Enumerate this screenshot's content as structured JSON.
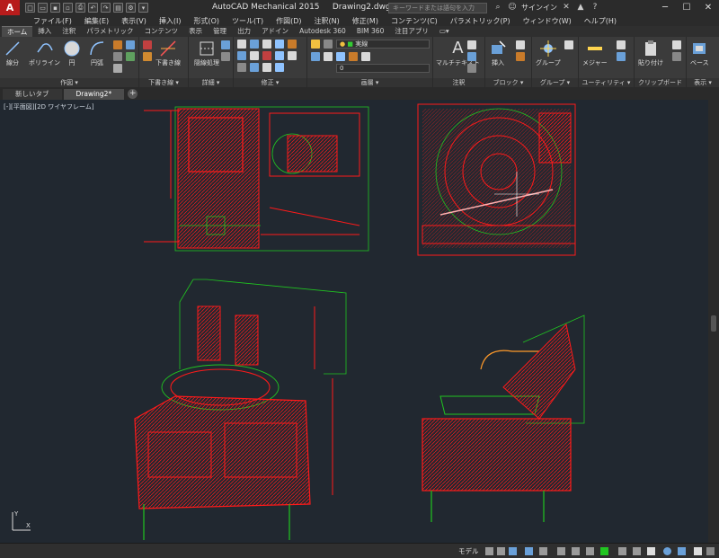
{
  "app": {
    "logo": "A",
    "title": "AutoCAD Mechanical 2015",
    "filename": "Drawing2.dwg"
  },
  "search": {
    "placeholder": "キーワードまたは語句を入力"
  },
  "account": {
    "signin": "サインイン"
  },
  "menu": [
    "ファイル(F)",
    "編集(E)",
    "表示(V)",
    "挿入(I)",
    "形式(O)",
    "ツール(T)",
    "作図(D)",
    "注釈(N)",
    "修正(M)",
    "コンテンツ(C)",
    "パラメトリック(P)",
    "ウィンドウ(W)",
    "ヘルプ(H)"
  ],
  "ribbon_tabs": [
    "ホーム",
    "挿入",
    "注釈",
    "パラメトリック",
    "コンテンツ",
    "表示",
    "管理",
    "出力",
    "アドイン",
    "Autodesk 360",
    "BIM 360",
    "注目アプリ"
  ],
  "ribbon_active_tab": "ホーム",
  "ribbon_panels": {
    "draw": {
      "label": "作図 ▾",
      "buttons": [
        "線分",
        "ポリライン",
        "円",
        "円弧"
      ]
    },
    "draft": {
      "label": "下書き線 ▾",
      "buttons": [
        "下書き線"
      ]
    },
    "detail": {
      "label": "詳細 ▾",
      "buttons": [
        "隠線処理"
      ]
    },
    "modify": {
      "label": "修正 ▾"
    },
    "layer": {
      "label": "画層 ▾",
      "current": "実線",
      "layer_value": "0"
    },
    "annotation": {
      "label": "注釈",
      "buttons": [
        "マルチテキスト"
      ]
    },
    "block": {
      "label": "ブロック ▾",
      "buttons": [
        "挿入"
      ]
    },
    "group": {
      "label": "グループ ▾",
      "buttons": [
        "グループ"
      ]
    },
    "utility": {
      "label": "ユーティリティ ▾",
      "buttons": [
        "メジャー"
      ]
    },
    "clipboard": {
      "label": "クリップボード",
      "buttons": [
        "貼り付け"
      ]
    },
    "view": {
      "label": "表示 ▾",
      "buttons": [
        "ベース"
      ]
    }
  },
  "file_tabs": [
    "新しいタブ",
    "Drawing2*"
  ],
  "file_tab_active": "Drawing2*",
  "viewport": {
    "label": "[-][平面図][2D ワイヤフレーム]"
  },
  "status": {
    "model": "モデル"
  },
  "colors": {
    "drawing_bg": "#212830",
    "geometry_red": "#ff1a1a",
    "geometry_green": "#21c521",
    "accent_red": "#b71c1c"
  }
}
